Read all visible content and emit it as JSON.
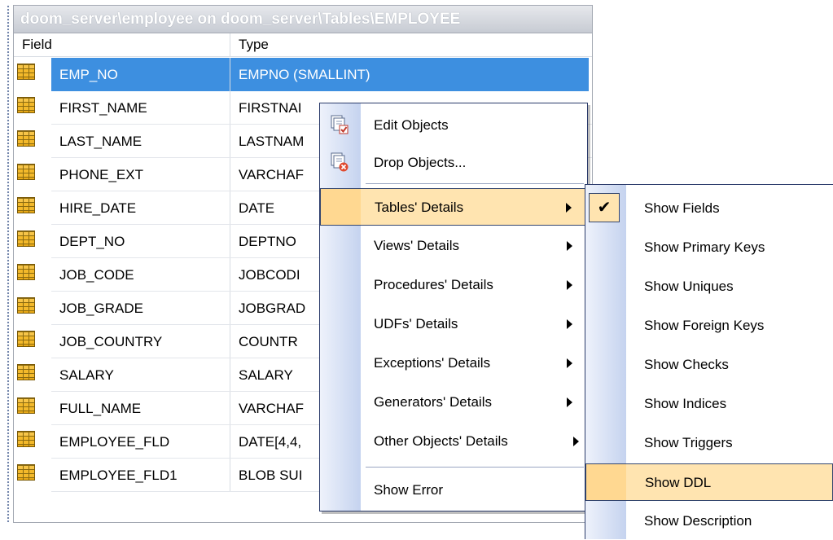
{
  "panel": {
    "title": "doom_server\\employee on doom_server\\Tables\\EMPLOYEE",
    "columns": {
      "field": "Field",
      "type": "Type"
    },
    "rows": [
      {
        "field": "EMP_NO",
        "type": "EMPNO (SMALLINT)"
      },
      {
        "field": "FIRST_NAME",
        "type": "FIRSTNAI"
      },
      {
        "field": "LAST_NAME",
        "type": "LASTNAM"
      },
      {
        "field": "PHONE_EXT",
        "type": "VARCHAF"
      },
      {
        "field": "HIRE_DATE",
        "type": "DATE"
      },
      {
        "field": "DEPT_NO",
        "type": "DEPTNO"
      },
      {
        "field": "JOB_CODE",
        "type": "JOBCODI"
      },
      {
        "field": "JOB_GRADE",
        "type": "JOBGRAD"
      },
      {
        "field": "JOB_COUNTRY",
        "type": "COUNTR"
      },
      {
        "field": "SALARY",
        "type": "SALARY"
      },
      {
        "field": "FULL_NAME",
        "type": "VARCHAF"
      },
      {
        "field": "EMPLOYEE_FLD",
        "type": "DATE[4,4,"
      },
      {
        "field": "EMPLOYEE_FLD1",
        "type": "BLOB SUI"
      }
    ],
    "selected_row": 0,
    "row_icon": "table-field-icon"
  },
  "context_menu": {
    "items": [
      {
        "label": "Edit Objects",
        "icon": "edit-objects-icon"
      },
      {
        "label": "Drop Objects...",
        "icon": "drop-objects-icon"
      },
      {
        "label": "Tables' Details",
        "submenu": true,
        "highlighted": true
      },
      {
        "label": "Views' Details",
        "submenu": true
      },
      {
        "label": "Procedures' Details",
        "submenu": true
      },
      {
        "label": "UDFs' Details",
        "submenu": true
      },
      {
        "label": "Exceptions' Details",
        "submenu": true
      },
      {
        "label": "Generators' Details",
        "submenu": true
      },
      {
        "label": "Other Objects' Details",
        "submenu": true
      },
      {
        "label": "Show Error"
      }
    ]
  },
  "submenu": {
    "items": [
      {
        "label": "Show Fields",
        "checked": true
      },
      {
        "label": "Show Primary Keys"
      },
      {
        "label": "Show Uniques"
      },
      {
        "label": "Show Foreign Keys"
      },
      {
        "label": "Show Checks"
      },
      {
        "label": "Show Indices"
      },
      {
        "label": "Show Triggers"
      },
      {
        "label": "Show DDL",
        "highlighted": true
      },
      {
        "label": "Show Description"
      }
    ]
  },
  "colors": {
    "selection": "#3d8fe0",
    "menu_highlight": "#ffe4b0",
    "menu_border": "#34466e"
  }
}
